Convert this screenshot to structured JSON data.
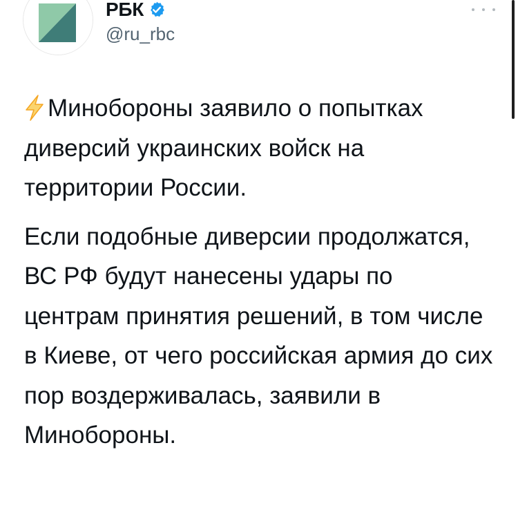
{
  "author": {
    "display_name": "РБК",
    "handle": "@ru_rbc",
    "verified_icon": "verified-badge-icon",
    "avatar_colors": {
      "dark_teal": "#3f7d78",
      "light_green": "#8fc9a8"
    }
  },
  "menu": {
    "more_icon": "more-horizontal-icon"
  },
  "tweet": {
    "lead_icon": "lightning-icon",
    "paragraph_1": "Минобороны заявило о попытках диверсий украинских войск на территории России.",
    "paragraph_2": "Если подобные диверсии продолжатся, ВС РФ будут нанесены удары по центрам принятия решений, в том числе в Киеве, от чего российская армия до сих пор воздерживалась, заявили в Минобороны."
  },
  "colors": {
    "text": "#0f1419",
    "secondary": "#536471",
    "verified": "#1d9bf0",
    "bolt": "#f5a623"
  }
}
